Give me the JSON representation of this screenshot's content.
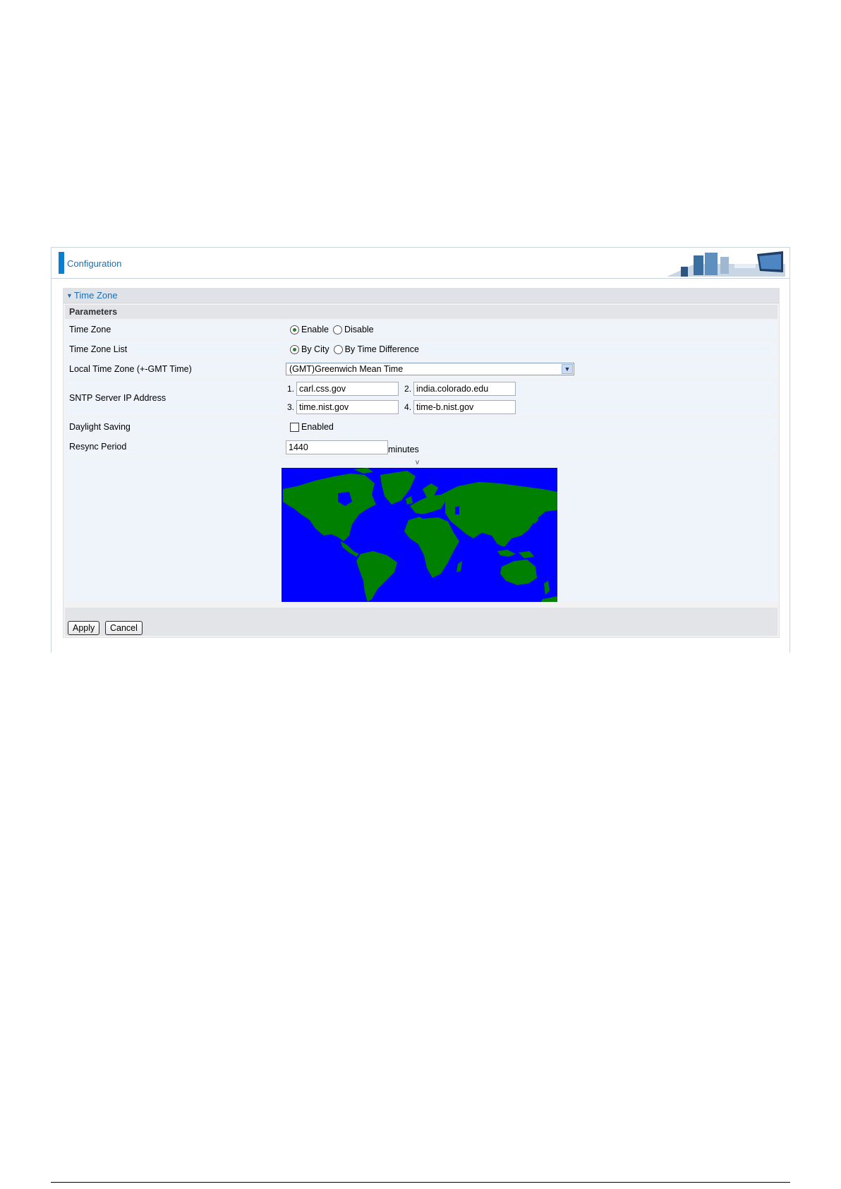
{
  "header": {
    "title": "Configuration"
  },
  "section": {
    "title": "Time Zone",
    "params_heading": "Parameters",
    "time_zone": {
      "label": "Time Zone",
      "options": [
        "Enable",
        "Disable"
      ],
      "selected": "Enable"
    },
    "time_zone_list": {
      "label": "Time Zone List",
      "options": [
        "By City",
        "By Time Difference"
      ],
      "selected": "By City"
    },
    "local_time_zone": {
      "label": "Local Time Zone (+-GMT Time)",
      "value": "(GMT)Greenwich Mean Time"
    },
    "sntp": {
      "label": "SNTP Server IP Address",
      "servers": [
        {
          "index": "1.",
          "value": "carl.css.gov"
        },
        {
          "index": "2.",
          "value": "india.colorado.edu"
        },
        {
          "index": "3.",
          "value": "time.nist.gov"
        },
        {
          "index": "4.",
          "value": "time-b.nist.gov"
        }
      ]
    },
    "daylight_saving": {
      "label": "Daylight Saving",
      "checkbox_label": "Enabled",
      "checked": false
    },
    "resync": {
      "label": "Resync Period",
      "value": "1440",
      "unit": "minutes"
    },
    "map": {
      "marker": "v",
      "ocean_color": "#0000ff",
      "land_color": "#008000"
    }
  },
  "buttons": {
    "apply": "Apply",
    "cancel": "Cancel"
  },
  "colors": {
    "accent": "#0a7fd0",
    "title_text": "#1a6fb5",
    "row_bg": "#eef4fa"
  }
}
